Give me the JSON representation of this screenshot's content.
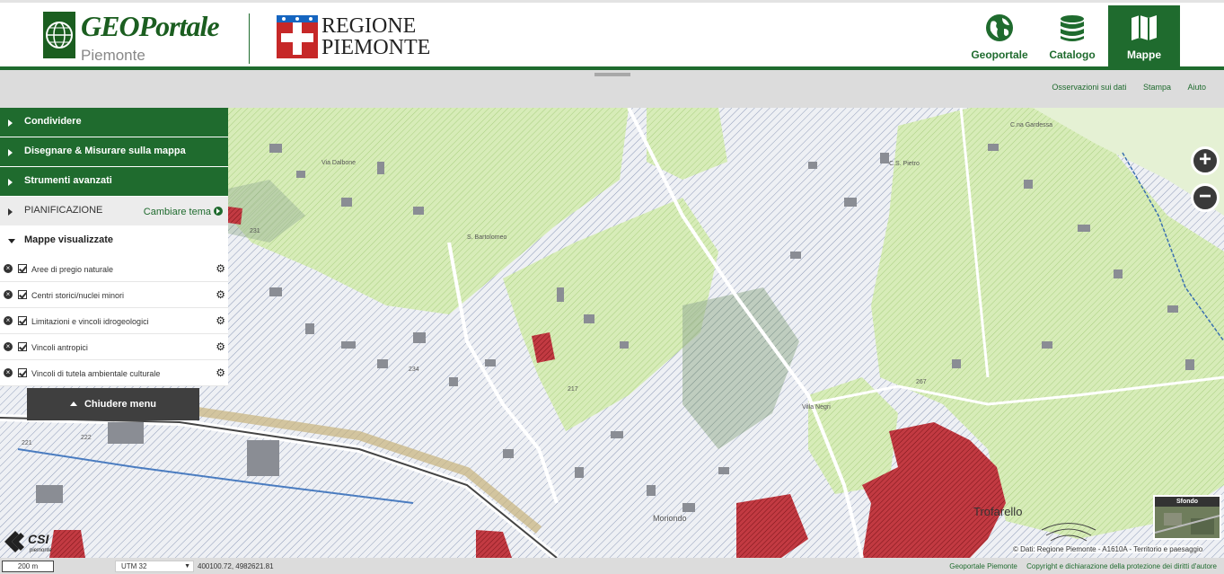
{
  "header": {
    "logo_title": "GEOPortale",
    "logo_subtitle": "Piemonte",
    "region_line1": "REGIONE",
    "region_line2": "PIEMONTE",
    "nav": [
      {
        "label": "Geoportale",
        "icon": "globe-icon"
      },
      {
        "label": "Catalogo",
        "icon": "database-icon"
      },
      {
        "label": "Mappe",
        "icon": "map-icon",
        "active": true
      }
    ]
  },
  "top_links": [
    "Osservazioni sui dati",
    "Stampa",
    "Aiuto"
  ],
  "sidebar": {
    "sections": [
      "Condividere",
      "Disegnare & Misurare sulla mappa",
      "Strumenti avanzati"
    ],
    "theme_label": "PIANIFICAZIONE",
    "theme_action": "Cambiare tema",
    "maps_header": "Mappe visualizzate",
    "layers": [
      "Aree di pregio naturale",
      "Centri storici/nuclei minori",
      "Limitazioni e vincoli idrogeologici",
      "Vincoli antropici",
      "Vincoli di tutela ambientale culturale"
    ],
    "close_menu": "Chiudere menu"
  },
  "map": {
    "place_labels": [
      "Via Dalbone",
      "S. Bartolomeo",
      "C.na Gardessa",
      "C.S. Pietro",
      "Moriondo",
      "Trofarello",
      "Villa Negri",
      "217",
      "222",
      "221",
      "267",
      "231",
      "234"
    ],
    "basemap_caption": "Sfondo",
    "attribution": "© Dati: Regione Piemonte - A1610A - Territorio e paesaggio",
    "zoom_in": "+",
    "zoom_out": "−"
  },
  "statusbar": {
    "scale": "200 m",
    "crs": "UTM 32",
    "coordinates": "400100.72, 4982621.81",
    "links": [
      "Geoportale Piemonte",
      "Copyright e dichiarazione della protezione dei diritti d'autore"
    ]
  },
  "colors": {
    "brand_green": "#1f6b2e",
    "urban_red": "#b22a32",
    "natural_green": "#c9e6a4"
  }
}
